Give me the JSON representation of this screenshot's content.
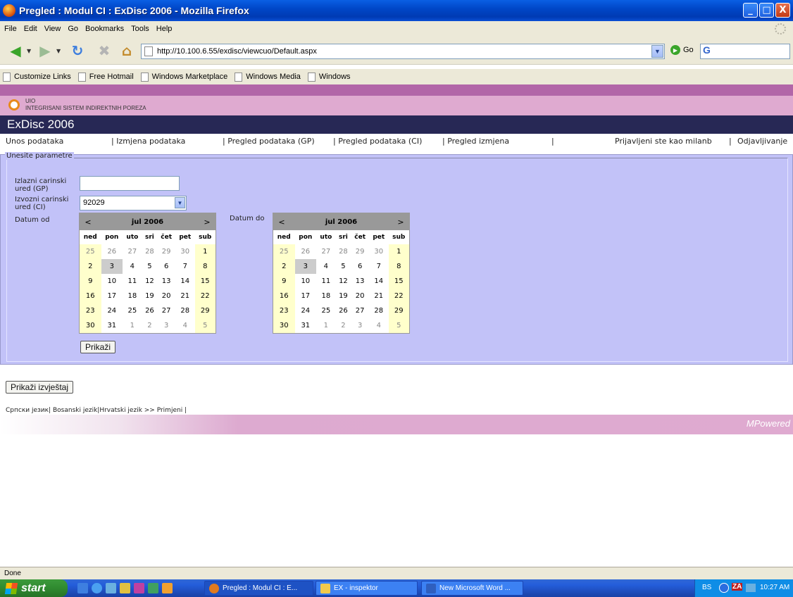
{
  "window": {
    "title": "Pregled : Modul CI : ExDisc 2006 - Mozilla Firefox",
    "controls": {
      "minimize": "_",
      "maximize": "□",
      "close": "X"
    }
  },
  "menu": [
    "File",
    "Edit",
    "View",
    "Go",
    "Bookmarks",
    "Tools",
    "Help"
  ],
  "toolbar": {
    "url": "http://10.100.6.55/exdisc/viewcuo/Default.aspx",
    "go_label": "Go",
    "search_logo": "G"
  },
  "bookmarks": [
    "Customize Links",
    "Free Hotmail",
    "Windows Marketplace",
    "Windows Media",
    "Windows"
  ],
  "page": {
    "logo_small": "UIO",
    "logo_text": "INTEGRISANI SISTEM INDIREKTNIH POREZA",
    "app_title": "ExDisc 2006",
    "nav": {
      "unos": "Unos podataka",
      "izmjena": "| Izmjena podataka",
      "pregled_gp": "| Pregled podataka (GP)",
      "pregled_ci": "| Pregled podataka (CI)",
      "pregled_izmjena": "| Pregled izmjena",
      "sep": "|",
      "logged_in": "Prijavljeni ste kao milanb",
      "sep2": "|",
      "logout": "Odjavljivanje"
    },
    "params": {
      "legend": "Unesite parametre",
      "gp_label_1": "Izlazni carinski",
      "gp_label_2": "ured (GP)",
      "gp_value": "",
      "ci_label_1": "Izvozni carinski",
      "ci_label_2": "ured (CI)",
      "ci_value": "92029",
      "datum_od": "Datum od",
      "datum_do": "Datum do",
      "prikazi": "Prikaži"
    },
    "calendar": {
      "prev": "<",
      "next": ">",
      "month": "jul 2006",
      "days": [
        "ned",
        "pon",
        "uto",
        "sri",
        "čet",
        "pet",
        "sub"
      ],
      "weeks": [
        [
          "25",
          "26",
          "27",
          "28",
          "29",
          "30",
          "1"
        ],
        [
          "2",
          "3",
          "4",
          "5",
          "6",
          "7",
          "8"
        ],
        [
          "9",
          "10",
          "11",
          "12",
          "13",
          "14",
          "15"
        ],
        [
          "16",
          "17",
          "18",
          "19",
          "20",
          "21",
          "22"
        ],
        [
          "23",
          "24",
          "25",
          "26",
          "27",
          "28",
          "29"
        ],
        [
          "30",
          "31",
          "1",
          "2",
          "3",
          "4",
          "5"
        ]
      ],
      "selected": "3"
    },
    "report_button": "Prikaži izvještaj",
    "languages": "Српски језик| Bosanski jezik|Hrvatski jezik  >> Primjeni |",
    "footer_brand": "MPowered"
  },
  "status": "Done",
  "taskbar": {
    "start": "start",
    "tasks": [
      "Pregled : Modul CI : E...",
      "EX - inspektor",
      "New Microsoft Word ..."
    ],
    "lang": "BS",
    "tray_icon_text": "ZA",
    "time": "10:27 AM"
  }
}
